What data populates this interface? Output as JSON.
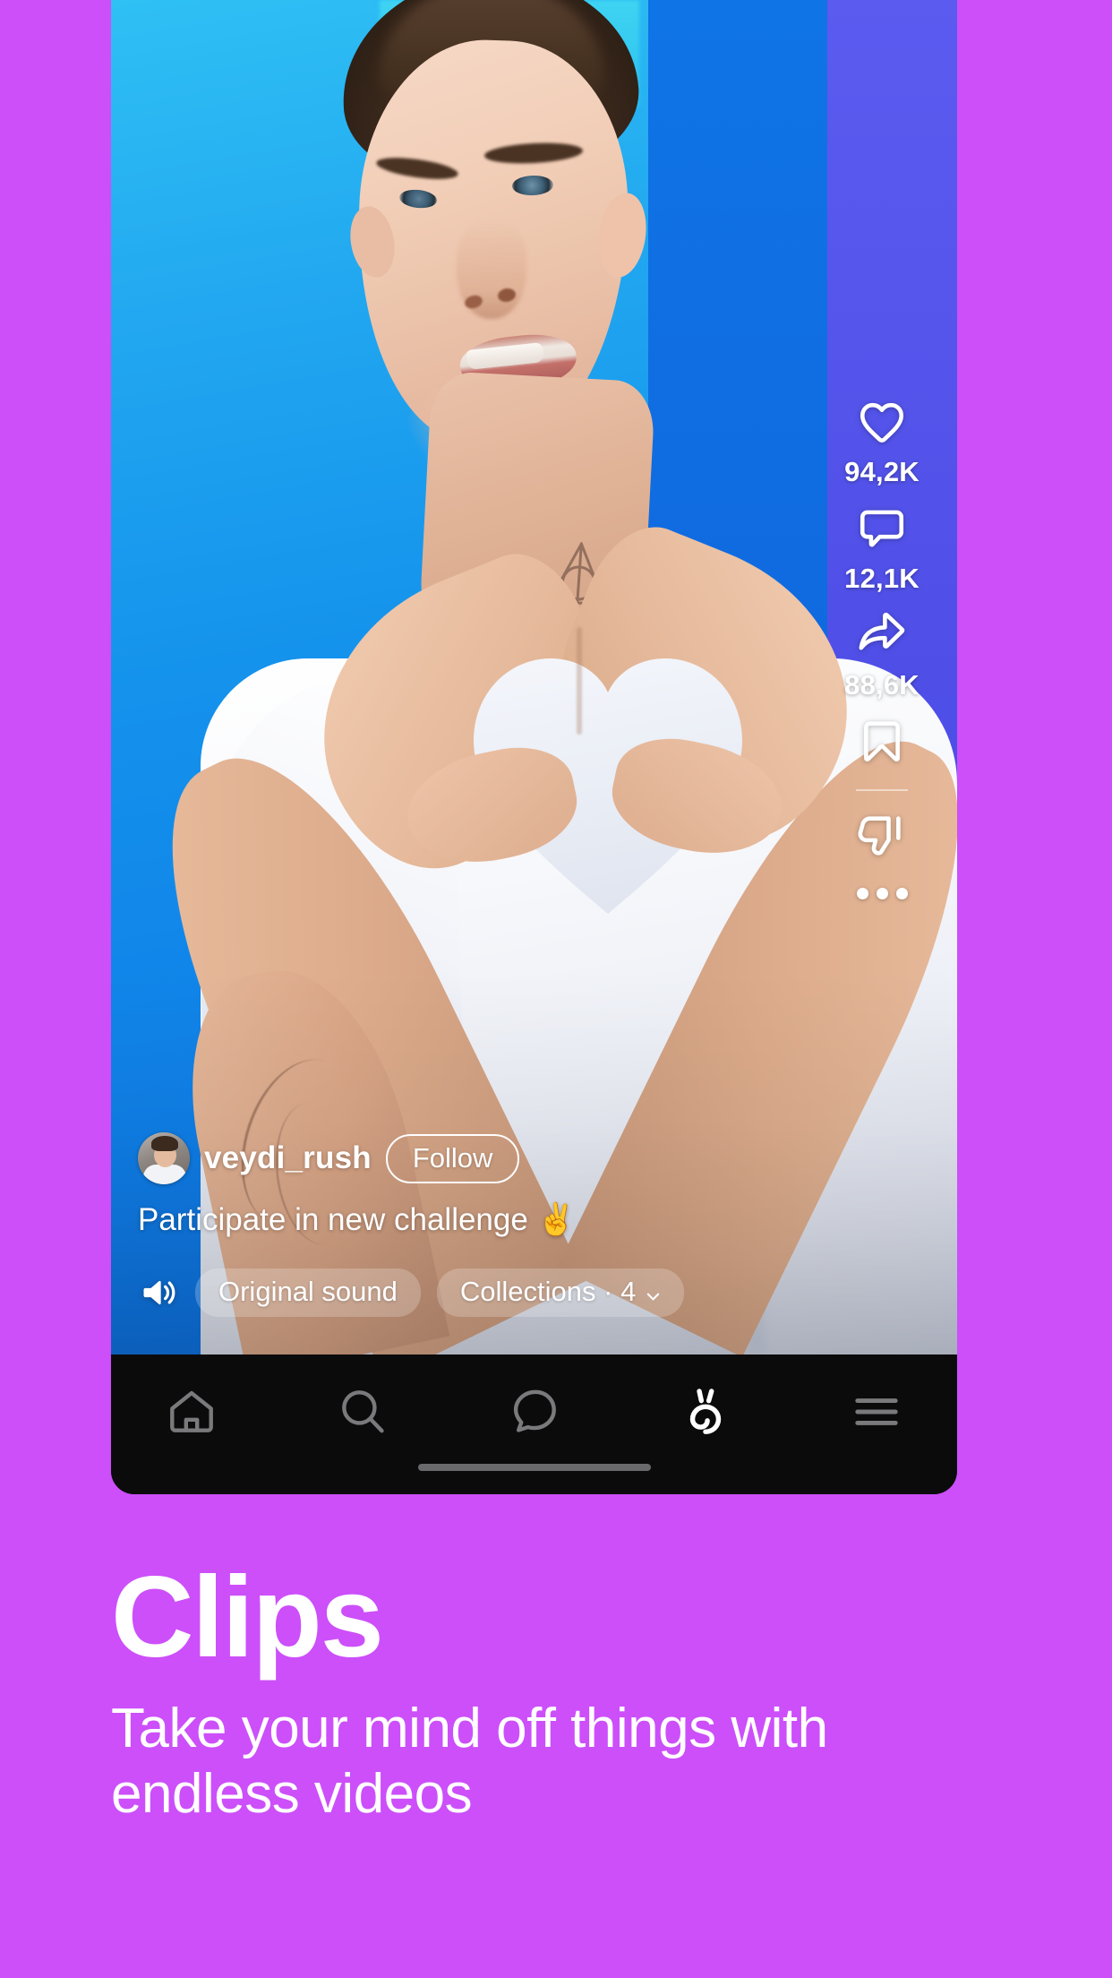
{
  "theme": {
    "background": "#cc4ffa",
    "nav_background": "#0b0b0c",
    "text_on_background": "#ffffff",
    "nav_active_color": "#ffffff",
    "nav_inactive_color": "#7a7a7c"
  },
  "video_post": {
    "actions": [
      {
        "name": "like",
        "icon": "heart-icon",
        "count": "94,2K"
      },
      {
        "name": "comment",
        "icon": "comment-icon",
        "count": "12,1K"
      },
      {
        "name": "share",
        "icon": "share-arrow-icon",
        "count": "88,6K"
      },
      {
        "name": "bookmark",
        "icon": "bookmark-icon",
        "count": ""
      },
      {
        "name": "dislike",
        "icon": "thumbs-down-icon",
        "count": ""
      },
      {
        "name": "more",
        "icon": "ellipsis-icon",
        "count": ""
      }
    ],
    "author": {
      "username": "veydi_rush",
      "follow_label": "Follow"
    },
    "caption": "Participate in new challenge ✌️",
    "sound": {
      "icon": "speaker-on-icon",
      "label": "Original sound"
    },
    "collections": {
      "label": "Collections · 4",
      "chevron": "chevron-down-icon"
    }
  },
  "bottom_nav": {
    "items": [
      {
        "name": "home",
        "icon": "home-icon",
        "active": false
      },
      {
        "name": "search",
        "icon": "search-icon",
        "active": false
      },
      {
        "name": "messages",
        "icon": "chat-bubble-icon",
        "active": false
      },
      {
        "name": "clips",
        "icon": "clips-logo-icon",
        "active": true
      },
      {
        "name": "menu",
        "icon": "hamburger-menu-icon",
        "active": false
      }
    ]
  },
  "promo": {
    "title": "Clips",
    "subtitle": "Take your mind off things with endless videos"
  }
}
